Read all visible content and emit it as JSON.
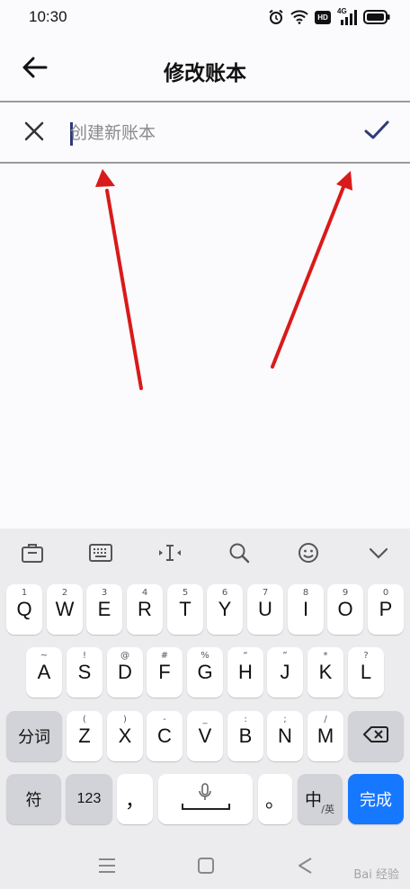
{
  "status_bar": {
    "time": "10:30",
    "network_badge": "HD",
    "network_type": "4G",
    "icons": [
      "alarm-icon",
      "wifi-icon",
      "hd-icon",
      "signal-icon",
      "battery-icon"
    ]
  },
  "header": {
    "title": "修改账本",
    "back_icon": "arrow-left-icon"
  },
  "edit_row": {
    "close_icon": "close-icon",
    "input_value": "",
    "input_placeholder": "创建新账本",
    "confirm_icon": "check-icon"
  },
  "annotations": {
    "arrow_color": "#d91a1a"
  },
  "keyboard": {
    "toolbar": [
      "clipboard-icon",
      "keyboard-icon",
      "cursor-icon",
      "search-icon",
      "emoji-icon",
      "chevron-down-icon"
    ],
    "row1": [
      {
        "label": "Q",
        "hint": "1"
      },
      {
        "label": "W",
        "hint": "2"
      },
      {
        "label": "E",
        "hint": "3"
      },
      {
        "label": "R",
        "hint": "4"
      },
      {
        "label": "T",
        "hint": "5"
      },
      {
        "label": "Y",
        "hint": "6"
      },
      {
        "label": "U",
        "hint": "7"
      },
      {
        "label": "I",
        "hint": "8"
      },
      {
        "label": "O",
        "hint": "9"
      },
      {
        "label": "P",
        "hint": "0"
      }
    ],
    "row2": [
      {
        "label": "A",
        "hint": "~"
      },
      {
        "label": "S",
        "hint": "!"
      },
      {
        "label": "D",
        "hint": "@"
      },
      {
        "label": "F",
        "hint": "#"
      },
      {
        "label": "G",
        "hint": "%"
      },
      {
        "label": "H",
        "hint": "“"
      },
      {
        "label": "J",
        "hint": "”"
      },
      {
        "label": "K",
        "hint": "*"
      },
      {
        "label": "L",
        "hint": "?"
      }
    ],
    "row3": [
      {
        "label": "Z",
        "hint": "("
      },
      {
        "label": "X",
        "hint": ")"
      },
      {
        "label": "C",
        "hint": "-"
      },
      {
        "label": "V",
        "hint": "_"
      },
      {
        "label": "B",
        "hint": ":"
      },
      {
        "label": "N",
        "hint": ";"
      },
      {
        "label": "M",
        "hint": "/"
      }
    ],
    "segment_key": "分词",
    "symbol_key": "符",
    "number_key": "123",
    "comma_key": "，",
    "period_key": "。",
    "lang_key_main": "中",
    "lang_key_sub": "/英",
    "done_key": "完成",
    "accent_color": "#1677ff"
  },
  "nav_bar": {
    "icons": [
      "menu-icon",
      "home-icon",
      "back-triangle-icon"
    ]
  },
  "watermark": "Bai 经验"
}
